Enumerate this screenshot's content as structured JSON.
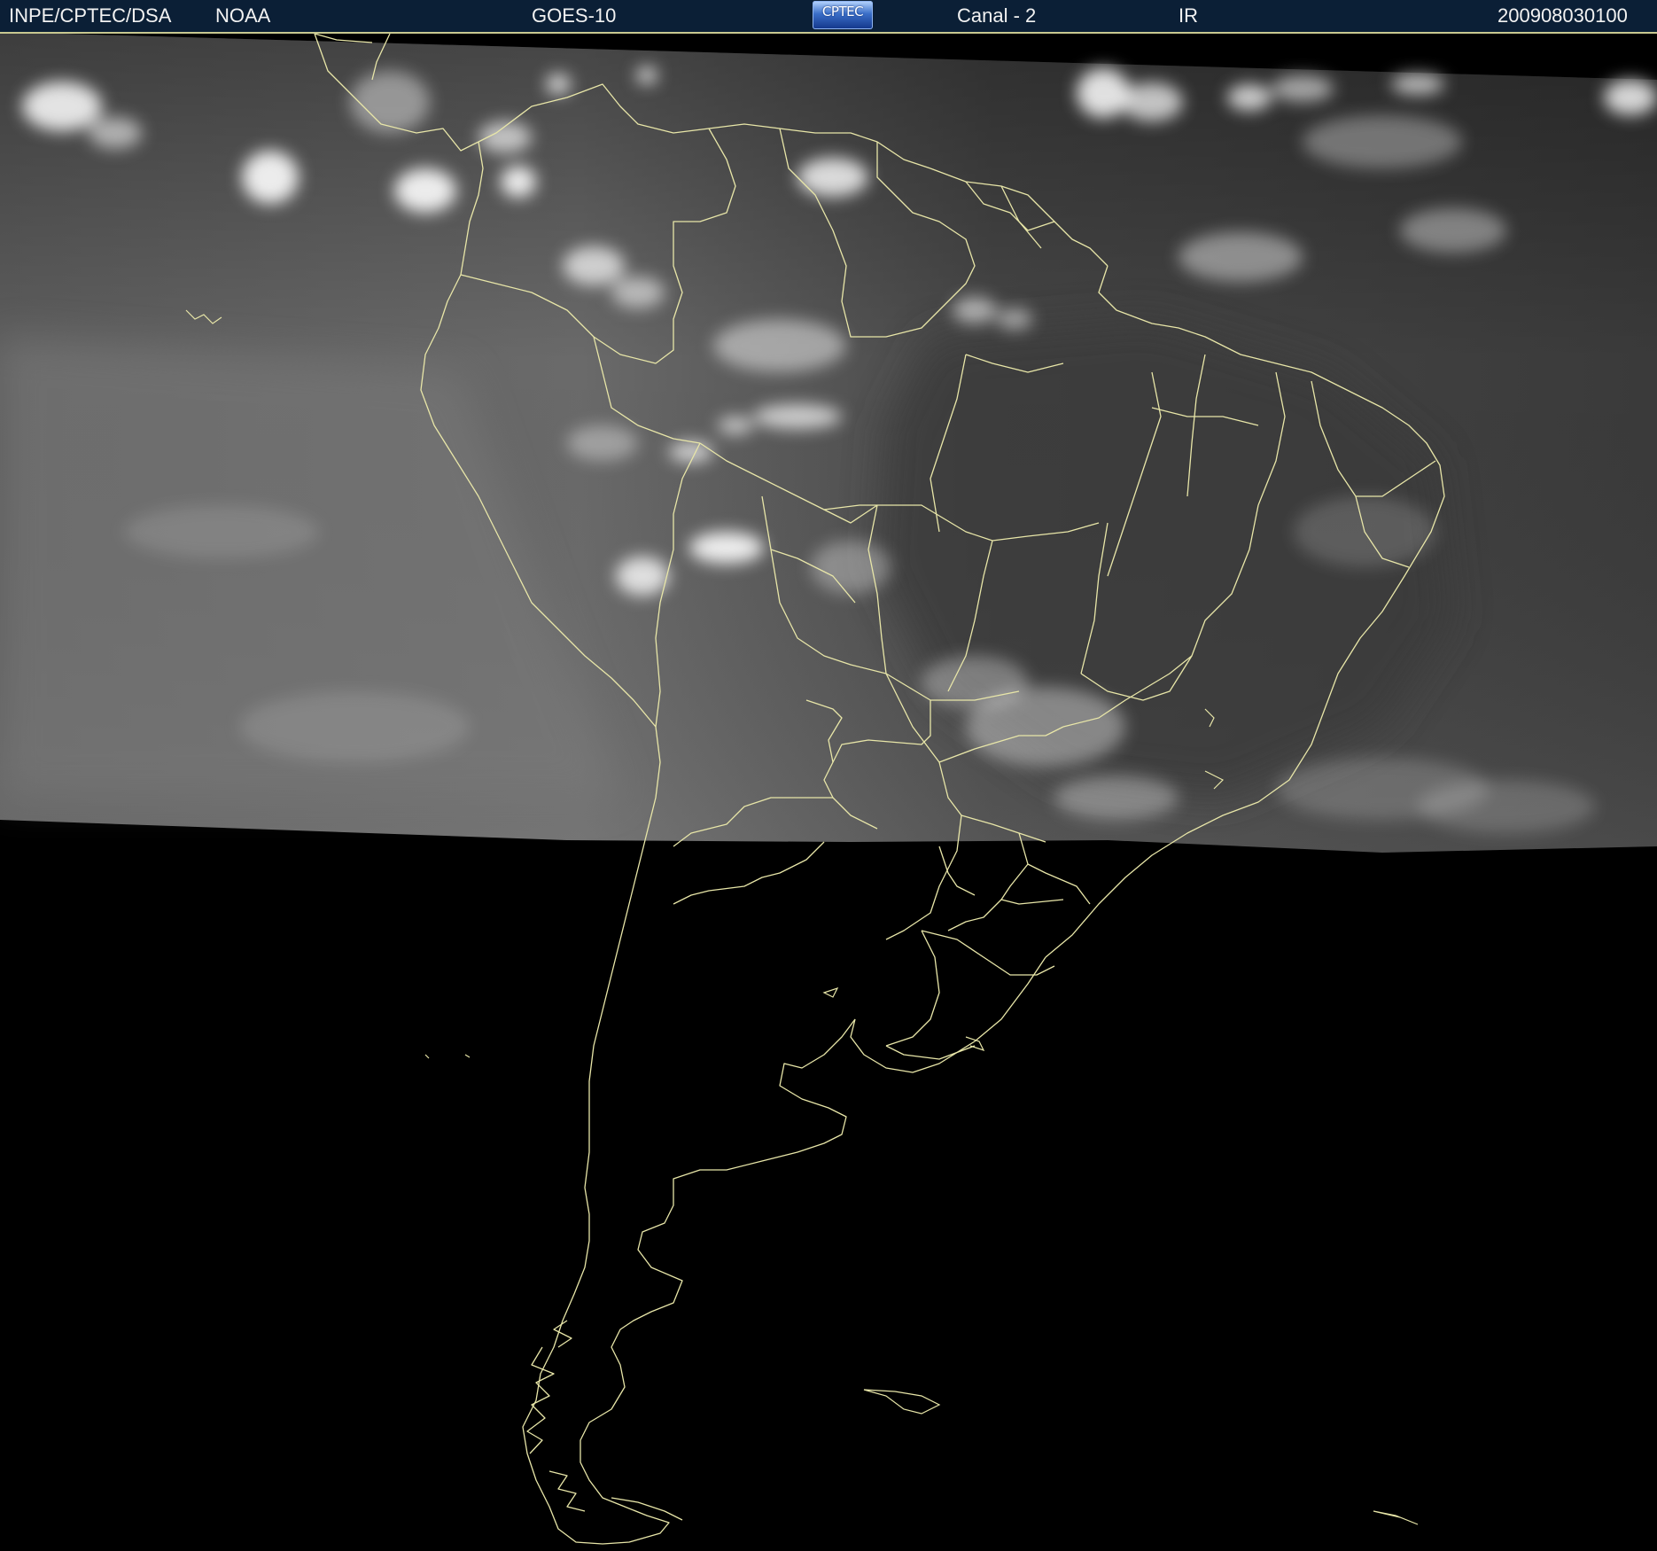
{
  "header": {
    "agency": "INPE/CPTEC/DSA",
    "source": "NOAA",
    "satellite": "GOES-10",
    "logo_text": "CPTEC",
    "channel": "Canal - 2",
    "band": "IR",
    "timestamp": "200908030100"
  },
  "colors": {
    "header_background": "#0b1f36",
    "coastline": "#e8e6a8",
    "night_background": "#000000",
    "cloud": "#f4f4f4"
  }
}
